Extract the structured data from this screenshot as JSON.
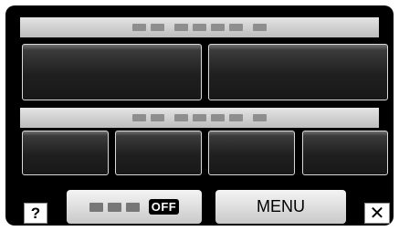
{
  "header_bar": {
    "label": ""
  },
  "section_bar": {
    "label": ""
  },
  "top_buttons": [
    {
      "label": ""
    },
    {
      "label": ""
    }
  ],
  "bottom_buttons": [
    {
      "label": ""
    },
    {
      "label": ""
    },
    {
      "label": ""
    },
    {
      "label": ""
    }
  ],
  "footer": {
    "help_label": "?",
    "toggle": {
      "label": "",
      "state": "OFF"
    },
    "menu_label": "MENU",
    "close_label": "✕"
  },
  "colors": {
    "screen_bg": "#000000",
    "bar_bg": "#d0d0d0",
    "button_border": "#d9d9d9"
  },
  "icons": {
    "help": "question-icon",
    "close": "close-icon"
  }
}
